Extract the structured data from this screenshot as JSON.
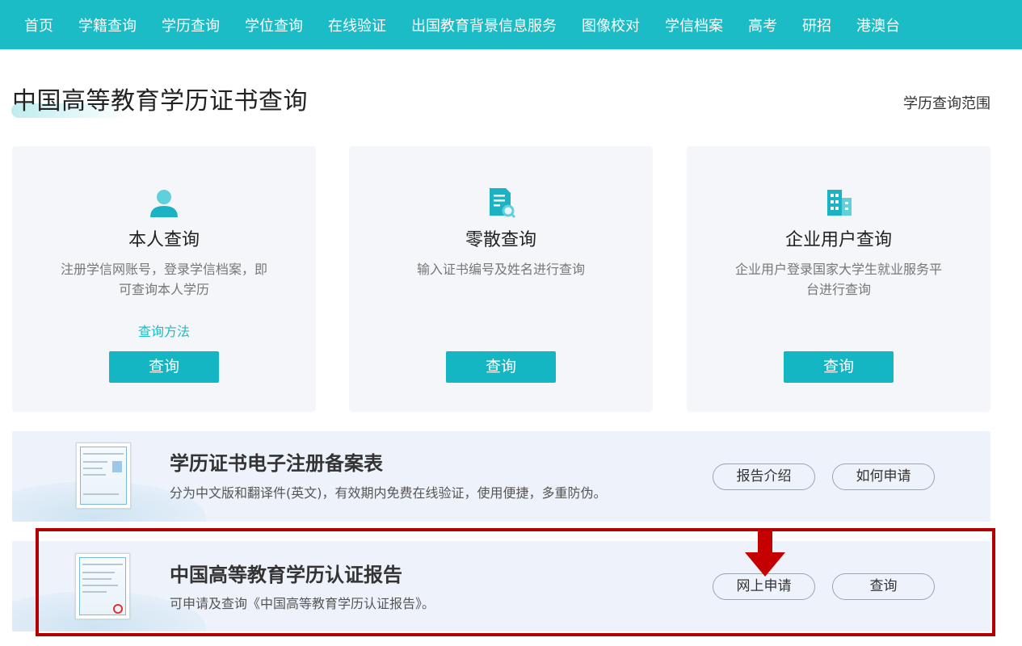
{
  "nav": {
    "items": [
      "首页",
      "学籍查询",
      "学历查询",
      "学位查询",
      "在线验证",
      "出国教育背景信息服务",
      "图像校对",
      "学信档案",
      "高考",
      "研招",
      "港澳台"
    ]
  },
  "page": {
    "title": "中国高等教育学历证书查询",
    "range_link": "学历查询范围"
  },
  "cards": [
    {
      "icon": "user-icon",
      "title": "本人查询",
      "desc_line1": "注册学信网账号，登录学信档案，即",
      "desc_line2": "可查询本人学历",
      "link": "查询方法",
      "button": "查询"
    },
    {
      "icon": "document-search-icon",
      "title": "零散查询",
      "desc_line1": "输入证书编号及姓名进行查询",
      "desc_line2": "",
      "link": "",
      "button": "查询"
    },
    {
      "icon": "building-icon",
      "title": "企业用户查询",
      "desc_line1": "企业用户登录国家大学生就业服务平",
      "desc_line2": "台进行查询",
      "link": "",
      "button": "查询"
    }
  ],
  "banners": [
    {
      "title": "学历证书电子注册备案表",
      "desc": "分为中文版和翻译件(英文)，有效期内免费在线验证，使用便捷，多重防伪。",
      "btn1": "报告介绍",
      "btn2": "如何申请"
    },
    {
      "title": "中国高等教育学历认证报告",
      "desc": "可申请及查询《中国高等教育学历认证报告》。",
      "btn1": "网上申请",
      "btn2": "查询"
    }
  ],
  "colors": {
    "accent": "#1bbcc6",
    "highlight": "#b40000",
    "card_bg": "#f4f6f9",
    "banner_bg": "#eef3fb"
  }
}
